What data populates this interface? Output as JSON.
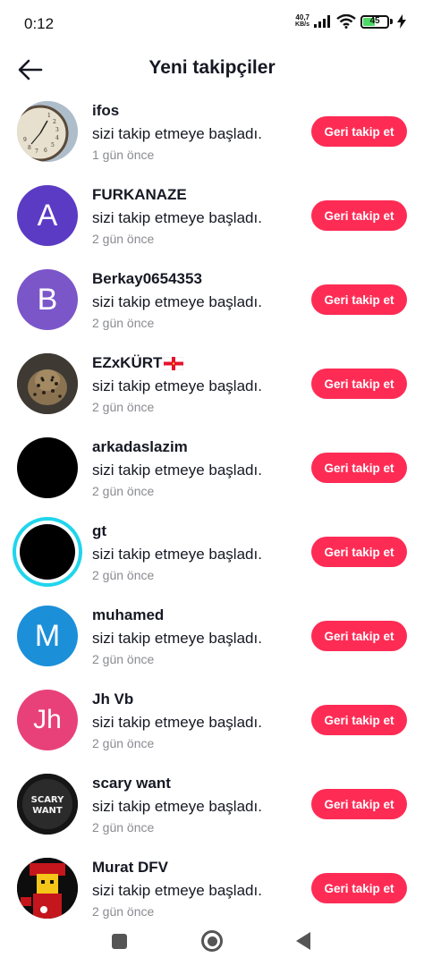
{
  "status_bar": {
    "time": "0:12",
    "net_speed_value": "40,7",
    "net_speed_unit": "KB/s",
    "battery_level": "45",
    "icons": [
      "signal-icon",
      "wifi-icon",
      "battery-icon",
      "charging-icon"
    ]
  },
  "header": {
    "title": "Yeni takipçiler",
    "back_icon": "arrow-left-icon"
  },
  "colors": {
    "accent": "#fe2c55",
    "story_ring": "#20d5ec",
    "avatar_purple_dark": "#5b3bc4",
    "avatar_purple": "#7b56c9",
    "avatar_blue": "#1c8fd9",
    "avatar_pink": "#e8417a"
  },
  "followers": [
    {
      "name": "ifos",
      "message": "sizi takip etmeye başladı.",
      "time": "1 gün önce",
      "button": "Geri takip et",
      "avatar_type": "image-clock"
    },
    {
      "name": "FURKANAZE",
      "message": "sizi takip etmeye başladı.",
      "time": "2 gün önce",
      "button": "Geri takip et",
      "avatar_type": "letter",
      "avatar_letter": "A"
    },
    {
      "name": "Berkay0654353",
      "message": "sizi takip etmeye başladı.",
      "time": "2 gün önce",
      "button": "Geri takip et",
      "avatar_type": "letter",
      "avatar_letter": "B"
    },
    {
      "name": "EZxKÜRT",
      "message": "sizi takip etmeye başladı.",
      "time": "2 gün önce",
      "button": "Geri takip et",
      "avatar_type": "image-leopard",
      "flag_icon": "flag-icon"
    },
    {
      "name": "arkadaslazim",
      "message": "sizi takip etmeye başladı.",
      "time": "2 gün önce",
      "button": "Geri takip et",
      "avatar_type": "black"
    },
    {
      "name": "gt",
      "message": "sizi takip etmeye başladı.",
      "time": "2 gün önce",
      "button": "Geri takip et",
      "avatar_type": "black-ring"
    },
    {
      "name": "muhamed",
      "message": "sizi takip etmeye başladı.",
      "time": "2 gün önce",
      "button": "Geri takip et",
      "avatar_type": "letter",
      "avatar_letter": "M"
    },
    {
      "name": "Jh Vb",
      "message": "sizi takip etmeye başladı.",
      "time": "2 gün önce",
      "button": "Geri takip et",
      "avatar_type": "letter",
      "avatar_letter": "Jh"
    },
    {
      "name": "scary want",
      "message": "sizi takip etmeye başladı.",
      "time": "2 gün önce",
      "button": "Geri takip et",
      "avatar_type": "image-logo",
      "avatar_logo_text": "SCARY WANT"
    },
    {
      "name": "Murat DFV",
      "message": "sizi takip etmeye başladı.",
      "time": "2 gün önce",
      "button": "Geri takip et",
      "avatar_type": "image-game"
    }
  ],
  "navbar": {
    "icons": [
      "recents-icon",
      "home-icon",
      "back-icon"
    ]
  }
}
